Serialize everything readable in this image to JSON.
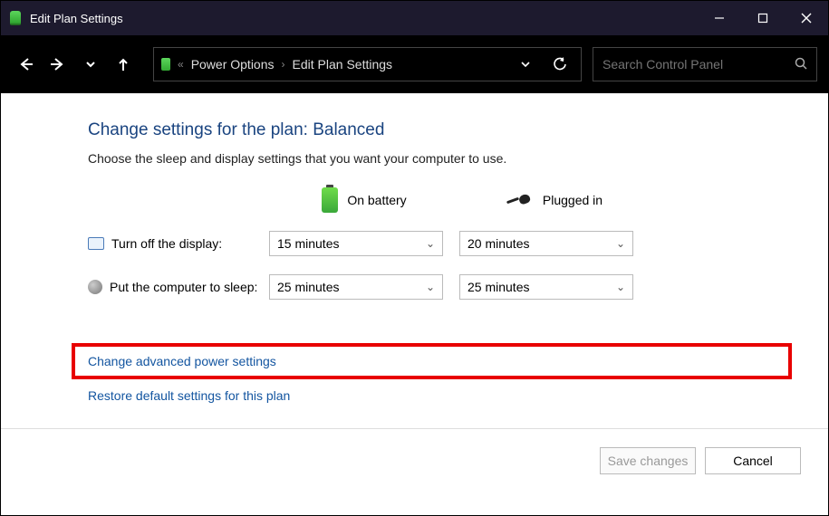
{
  "titlebar": {
    "title": "Edit Plan Settings"
  },
  "breadcrumb": {
    "item1": "Power Options",
    "item2": "Edit Plan Settings"
  },
  "search": {
    "placeholder": "Search Control Panel"
  },
  "heading": "Change settings for the plan: Balanced",
  "subtext": "Choose the sleep and display settings that you want your computer to use.",
  "columns": {
    "battery": "On battery",
    "plugged": "Plugged in"
  },
  "rows": {
    "display": {
      "label": "Turn off the display:",
      "battery": "15 minutes",
      "plugged": "20 minutes"
    },
    "sleep": {
      "label": "Put the computer to sleep:",
      "battery": "25 minutes",
      "plugged": "25 minutes"
    }
  },
  "links": {
    "advanced": "Change advanced power settings",
    "restore": "Restore default settings for this plan"
  },
  "buttons": {
    "save": "Save changes",
    "cancel": "Cancel"
  }
}
